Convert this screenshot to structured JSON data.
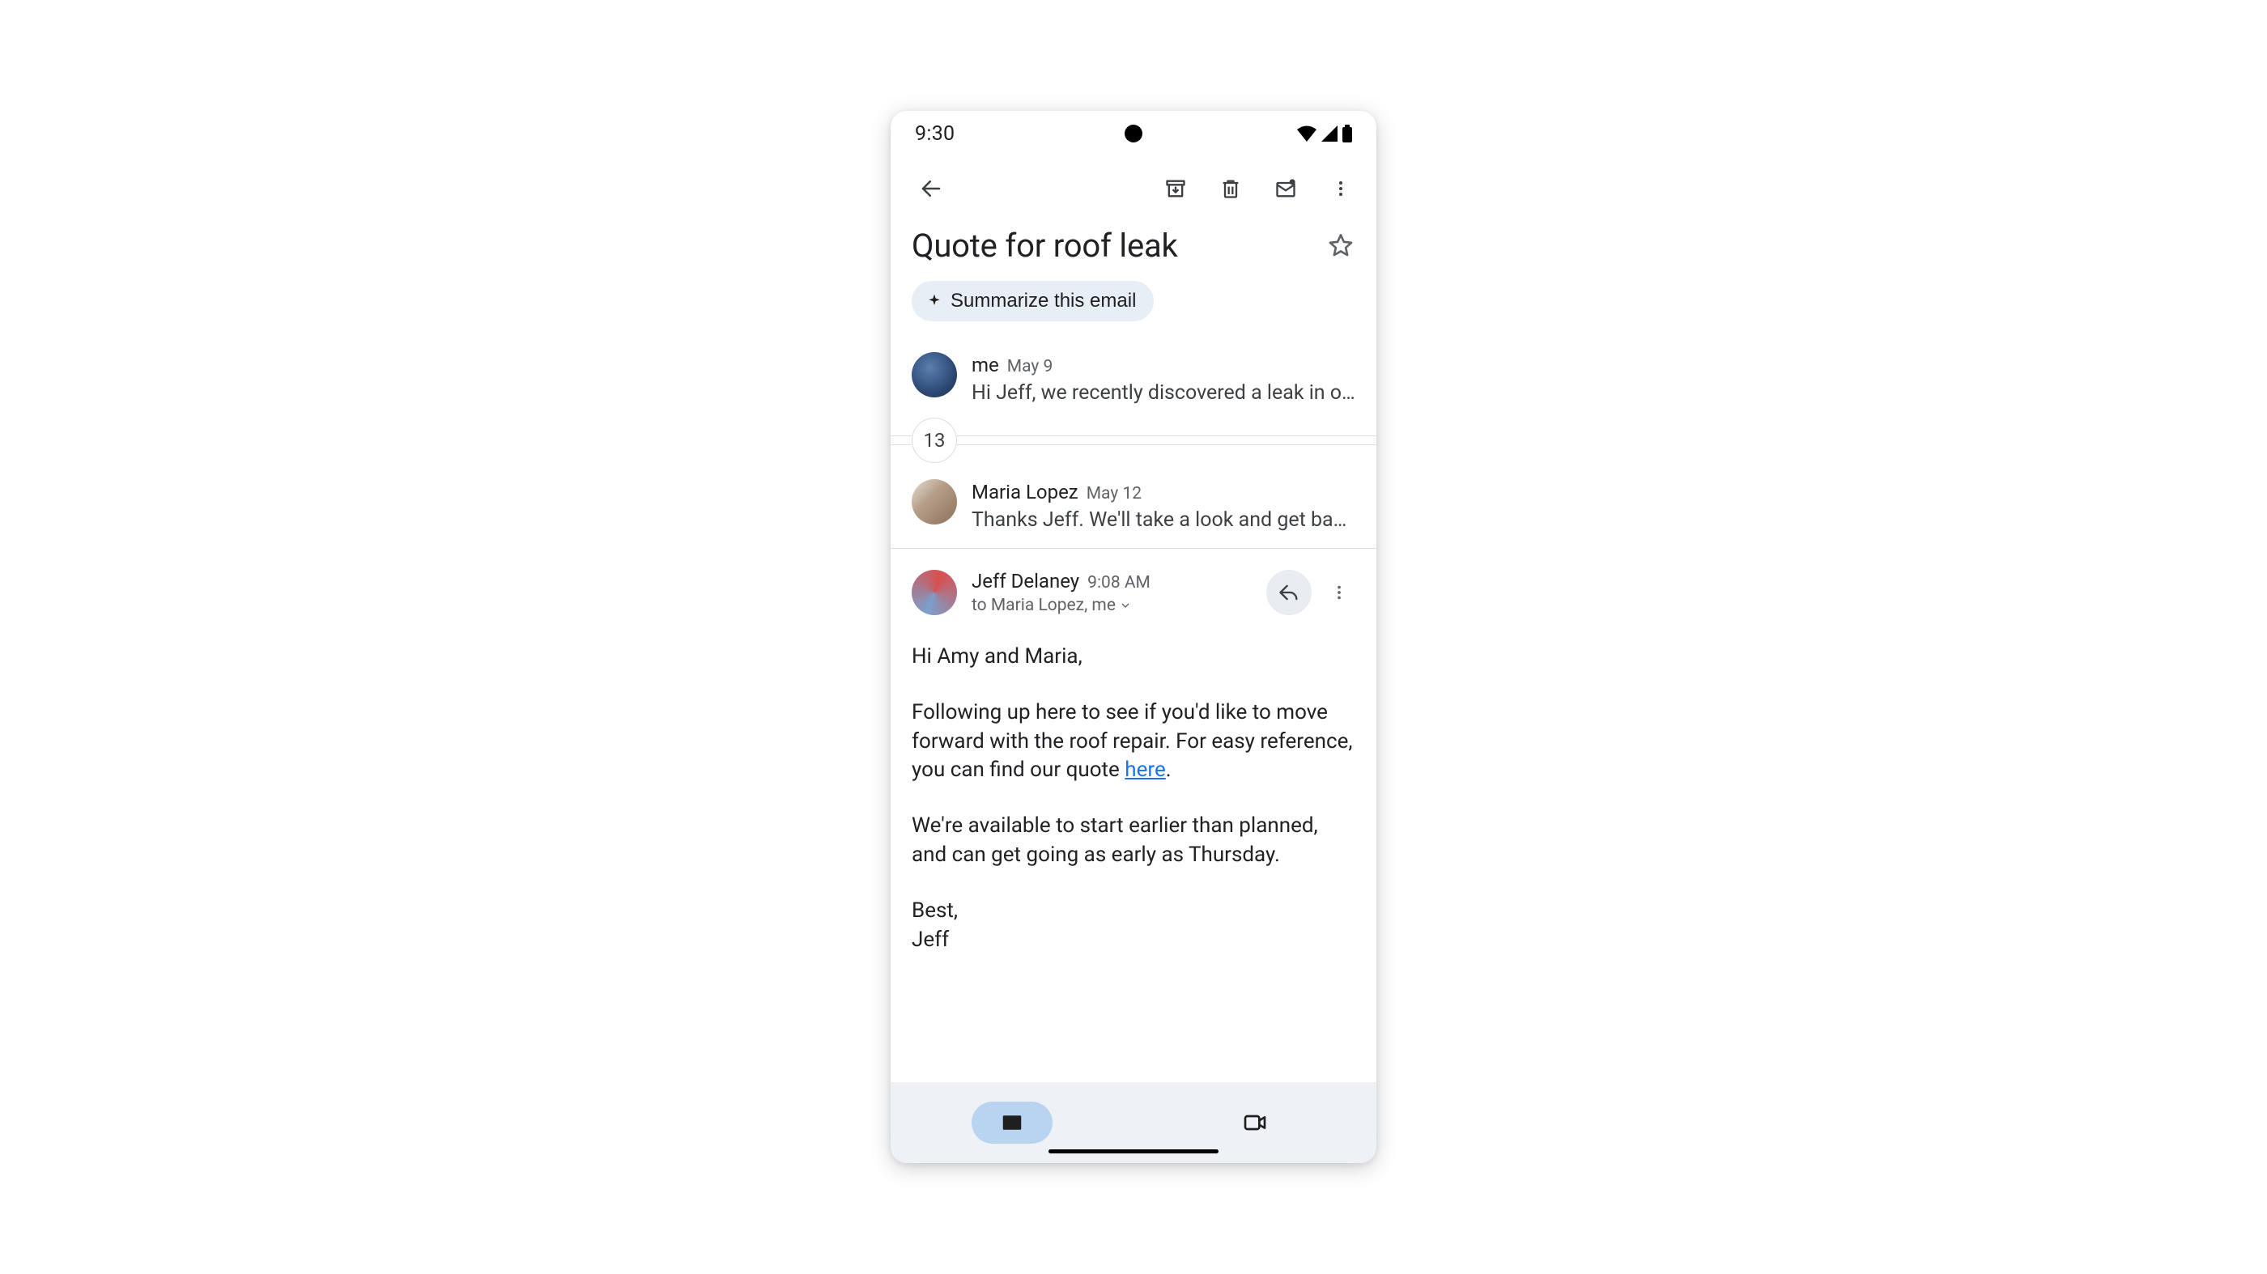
{
  "status": {
    "time": "9:30"
  },
  "subject": "Quote for roof leak",
  "summarize_label": "Summarize this email",
  "collapsed_count": "13",
  "messages": {
    "m0": {
      "sender": "me",
      "date": "May 9",
      "snippet": "Hi Jeff, we recently discovered a leak in our roof…"
    },
    "m1": {
      "sender": "Maria Lopez",
      "date": "May 12",
      "snippet": "Thanks Jeff. We'll take a look and get back to you…"
    },
    "m2": {
      "sender": "Jeff Delaney",
      "time": "9:08 AM",
      "recipients": "to Maria Lopez, me",
      "body": {
        "greeting": "Hi Amy and Maria,",
        "p1a": "Following up here to see if you'd like to move forward with the roof repair. For easy reference, you can find our quote ",
        "link": "here",
        "p1b": ".",
        "p2": "We're available to start earlier than planned, and can get going as early as Thursday.",
        "closing": "Best,",
        "signature": "Jeff"
      }
    }
  }
}
